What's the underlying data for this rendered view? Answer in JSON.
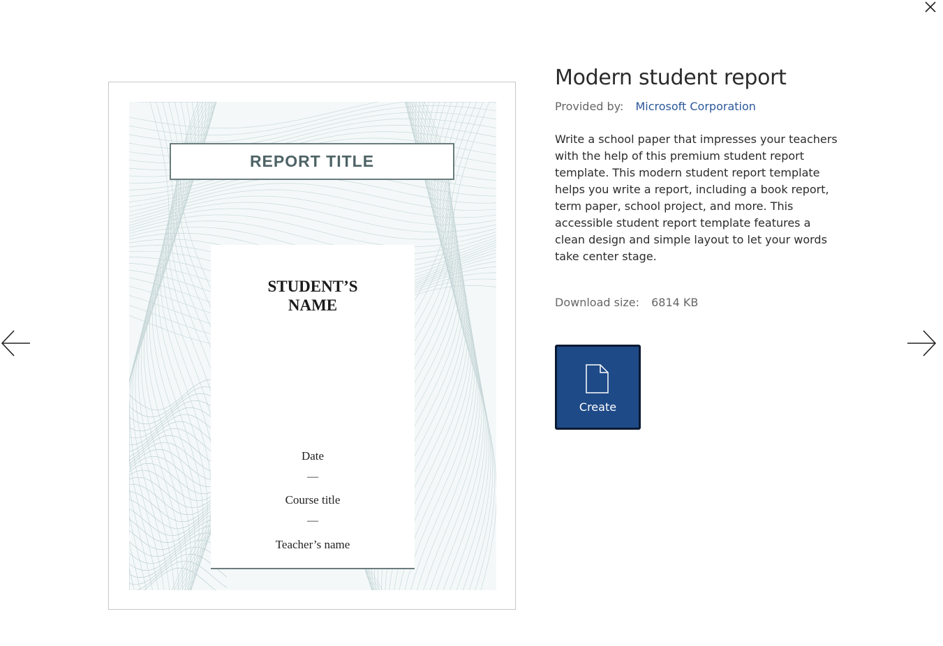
{
  "dialog": {
    "close_icon": "close-icon",
    "prev_icon": "arrow-left-icon",
    "next_icon": "arrow-right-icon"
  },
  "preview": {
    "report_title": "REPORT TITLE",
    "student_name": "STUDENT’S\nNAME",
    "date": "Date",
    "dash": "—",
    "course_title": "Course title",
    "teacher_name": "Teacher’s name"
  },
  "template": {
    "title": "Modern student report",
    "provided_by_label": "Provided by:",
    "provider": "Microsoft Corporation",
    "description": "Write a school paper that impresses your teachers with the help of this premium student report template. This modern student report template helps you write a report, including a book report, term paper, school project, and more. This accessible student report template features a clean design and simple layout to let your words take center stage.",
    "download_size_label": "Download size:",
    "download_size_value": "6814 KB",
    "create_label": "Create",
    "create_icon": "document-icon"
  },
  "colors": {
    "accent": "#1e4a87",
    "link": "#2b579a",
    "title_box_text": "#4e6366"
  }
}
